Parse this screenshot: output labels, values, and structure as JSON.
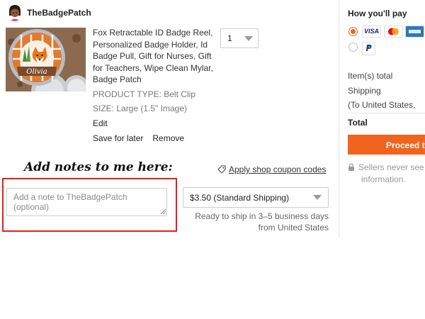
{
  "shop": {
    "name": "TheBadgePatch",
    "avatar_icon": "avatar-icon"
  },
  "item": {
    "image_text": "Olivia",
    "title": "Fox Retractable ID Badge Reel, Personalized Badge Holder, Id Badge Pull, Gift for Nurses, Gift for Teachers, Wipe Clean Mylar, Badge Patch",
    "product_type": "PRODUCT TYPE: Belt Clip",
    "size": "SIZE: Large (1.5\" Image)",
    "edit_label": "Edit",
    "save_for_later_label": "Save for later",
    "remove_label": "Remove",
    "quantity": "1"
  },
  "notes": {
    "annotation": "Add notes to me here:",
    "placeholder": "Add a note to TheBadgePatch (optional)",
    "highlight_color": "#e02020"
  },
  "coupon": {
    "label": "Apply shop coupon codes",
    "icon": "tag-icon"
  },
  "shipping": {
    "selected": "$3.50 (Standard Shipping)",
    "ready_line1": "Ready to ship in 3–5 business days",
    "ready_line2": "from United States"
  },
  "payment": {
    "heading": "How you'll pay",
    "card_icons": [
      "visa-icon",
      "mastercard-icon",
      "amex-icon"
    ],
    "card_visa_text": "VISA",
    "paypal_icon": "paypal-icon",
    "selected_method": "cards"
  },
  "summary": {
    "items_total_label": "Item(s) total",
    "shipping_label": "Shipping",
    "shipping_destination": "(To United States,",
    "total_label": "Total"
  },
  "checkout": {
    "proceed_label": "Proceed to",
    "seller_note_line1": "Sellers never see",
    "seller_note_line2": "information.",
    "accent_color": "#f1641e"
  }
}
